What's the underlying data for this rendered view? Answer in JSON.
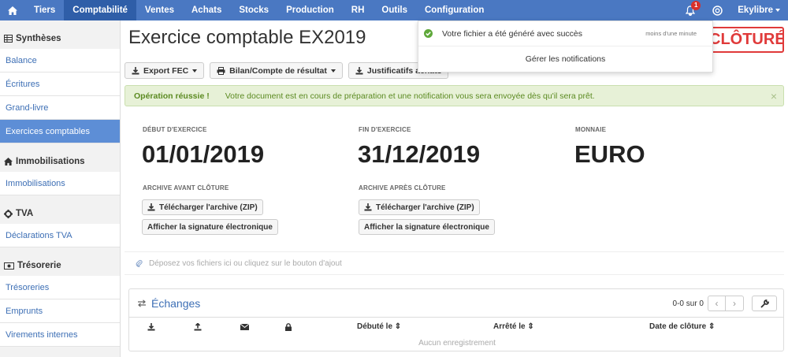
{
  "topnav": {
    "items": [
      "Tiers",
      "Comptabilité",
      "Ventes",
      "Achats",
      "Stocks",
      "Production",
      "RH",
      "Outils",
      "Configuration"
    ],
    "active": "Comptabilité",
    "badge": "1",
    "user": "Ekylibre",
    "color": "#4a78c2"
  },
  "sidebar": {
    "sections": [
      {
        "title": "Synthèses",
        "icon": "table-icon",
        "items": [
          "Balance",
          "Écritures",
          "Grand-livre",
          "Exercices comptables"
        ]
      },
      {
        "title": "Immobilisations",
        "icon": "home-icon",
        "items": [
          "Immobilisations"
        ]
      },
      {
        "title": "TVA",
        "icon": "gear-icon",
        "items": [
          "Déclarations TVA"
        ]
      },
      {
        "title": "Trésorerie",
        "icon": "money-icon",
        "items": [
          "Trésoreries",
          "Emprunts",
          "Virements internes"
        ]
      }
    ],
    "active": "Exercices comptables"
  },
  "page": {
    "title": "Exercice comptable EX2019",
    "status": "CLÔTURÉ"
  },
  "toolbar": {
    "export_fec": "Export FEC",
    "bilan": "Bilan/Compte de résultat",
    "justificatifs": "Justificatifs achats"
  },
  "alert": {
    "strong": "Opération réussie !",
    "message": "Votre document est en cours de préparation et une notification vous sera envoyée dès qu'il sera prêt.",
    "close": "×"
  },
  "details": {
    "start_label": "DÉBUT D'EXERCICE",
    "start_value": "01/01/2019",
    "end_label": "FIN D'EXERCICE",
    "end_value": "31/12/2019",
    "currency_label": "MONNAIE",
    "currency_value": "EURO",
    "archive_before_label": "ARCHIVE AVANT CLÔTURE",
    "archive_after_label": "ARCHIVE APRÈS CLÔTURE",
    "download_zip": "Télécharger l'archive (ZIP)",
    "show_signature": "Afficher la signature électronique"
  },
  "dropzone": {
    "text": "Déposez vos fichiers ici ou cliquez sur le bouton d'ajout"
  },
  "exchanges": {
    "title": "Échanges",
    "pager": "0-0 sur 0",
    "columns": [
      "Débuté le",
      "Arrêté le",
      "Date de clôture"
    ],
    "empty": "Aucun enregistrement"
  },
  "notification": {
    "message": "Votre fichier a été généré avec succès",
    "time": "moins d'une minute",
    "manage": "Gérer les notifications"
  }
}
